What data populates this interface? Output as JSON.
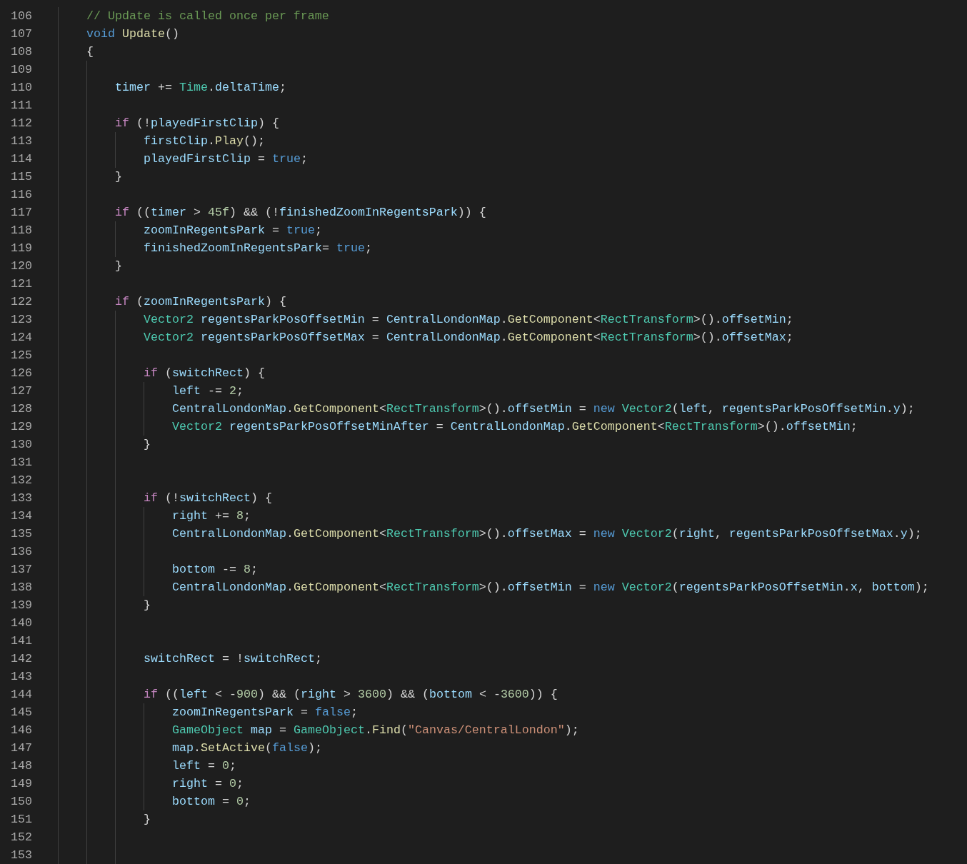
{
  "editor": {
    "lines": [
      {
        "number": "106",
        "tokens": [
          {
            "kind": "comment",
            "text": "// Update is called once per frame"
          }
        ]
      },
      {
        "number": "107",
        "tokens": [
          {
            "kind": "keyword",
            "text": "void "
          },
          {
            "kind": "function",
            "text": "Update"
          },
          {
            "kind": "plain",
            "text": "()"
          }
        ]
      },
      {
        "number": "108",
        "tokens": [
          {
            "kind": "plain",
            "text": "{"
          }
        ],
        "children": [
          {
            "number": "109"
          },
          {
            "number": "110",
            "tokens": [
              {
                "kind": "variable",
                "text": "timer"
              },
              {
                "kind": "plain",
                "text": " += "
              },
              {
                "kind": "type",
                "text": "Time"
              },
              {
                "kind": "plain",
                "text": "."
              },
              {
                "kind": "variable",
                "text": "deltaTime"
              },
              {
                "kind": "plain",
                "text": ";"
              }
            ]
          },
          {
            "number": "111"
          },
          {
            "number": "112",
            "tokens": [
              {
                "kind": "control",
                "text": "if"
              },
              {
                "kind": "plain",
                "text": " (!"
              },
              {
                "kind": "variable",
                "text": "playedFirstClip"
              },
              {
                "kind": "plain",
                "text": ") {"
              }
            ],
            "children": [
              {
                "number": "113",
                "tokens": [
                  {
                    "kind": "variable",
                    "text": "firstClip"
                  },
                  {
                    "kind": "plain",
                    "text": "."
                  },
                  {
                    "kind": "function",
                    "text": "Play"
                  },
                  {
                    "kind": "plain",
                    "text": "();"
                  }
                ]
              },
              {
                "number": "114",
                "tokens": [
                  {
                    "kind": "variable",
                    "text": "playedFirstClip"
                  },
                  {
                    "kind": "plain",
                    "text": " = "
                  },
                  {
                    "kind": "keyword",
                    "text": "true"
                  },
                  {
                    "kind": "plain",
                    "text": ";"
                  }
                ]
              }
            ]
          },
          {
            "number": "115",
            "tokens": [
              {
                "kind": "plain",
                "text": "}"
              }
            ]
          },
          {
            "number": "116"
          },
          {
            "number": "117",
            "tokens": [
              {
                "kind": "control",
                "text": "if"
              },
              {
                "kind": "plain",
                "text": " (("
              },
              {
                "kind": "variable",
                "text": "timer"
              },
              {
                "kind": "plain",
                "text": " > "
              },
              {
                "kind": "number",
                "text": "45f"
              },
              {
                "kind": "plain",
                "text": ") && (!"
              },
              {
                "kind": "variable",
                "text": "finishedZoomInRegentsPark"
              },
              {
                "kind": "plain",
                "text": ")) {"
              }
            ],
            "children": [
              {
                "number": "118",
                "tokens": [
                  {
                    "kind": "variable",
                    "text": "zoomInRegentsPark"
                  },
                  {
                    "kind": "plain",
                    "text": " = "
                  },
                  {
                    "kind": "keyword",
                    "text": "true"
                  },
                  {
                    "kind": "plain",
                    "text": ";"
                  }
                ]
              },
              {
                "number": "119",
                "tokens": [
                  {
                    "kind": "variable",
                    "text": "finishedZoomInRegentsPark"
                  },
                  {
                    "kind": "plain",
                    "text": "= "
                  },
                  {
                    "kind": "keyword",
                    "text": "true"
                  },
                  {
                    "kind": "plain",
                    "text": ";"
                  }
                ]
              }
            ]
          },
          {
            "number": "120",
            "tokens": [
              {
                "kind": "plain",
                "text": "}"
              }
            ]
          },
          {
            "number": "121"
          },
          {
            "number": "122",
            "tokens": [
              {
                "kind": "control",
                "text": "if"
              },
              {
                "kind": "plain",
                "text": " ("
              },
              {
                "kind": "variable",
                "text": "zoomInRegentsPark"
              },
              {
                "kind": "plain",
                "text": ") {"
              }
            ],
            "children": [
              {
                "number": "123",
                "tokens": [
                  {
                    "kind": "type",
                    "text": "Vector2 "
                  },
                  {
                    "kind": "variable",
                    "text": "regentsParkPosOffsetMin"
                  },
                  {
                    "kind": "plain",
                    "text": " = "
                  },
                  {
                    "kind": "variable",
                    "text": "CentralLondonMap"
                  },
                  {
                    "kind": "plain",
                    "text": "."
                  },
                  {
                    "kind": "function",
                    "text": "GetComponent"
                  },
                  {
                    "kind": "plain",
                    "text": "<"
                  },
                  {
                    "kind": "type",
                    "text": "RectTransform"
                  },
                  {
                    "kind": "plain",
                    "text": ">()."
                  },
                  {
                    "kind": "variable",
                    "text": "offsetMin"
                  },
                  {
                    "kind": "plain",
                    "text": ";"
                  }
                ]
              },
              {
                "number": "124",
                "tokens": [
                  {
                    "kind": "type",
                    "text": "Vector2 "
                  },
                  {
                    "kind": "variable",
                    "text": "regentsParkPosOffsetMax"
                  },
                  {
                    "kind": "plain",
                    "text": " = "
                  },
                  {
                    "kind": "variable",
                    "text": "CentralLondonMap"
                  },
                  {
                    "kind": "plain",
                    "text": "."
                  },
                  {
                    "kind": "function",
                    "text": "GetComponent"
                  },
                  {
                    "kind": "plain",
                    "text": "<"
                  },
                  {
                    "kind": "type",
                    "text": "RectTransform"
                  },
                  {
                    "kind": "plain",
                    "text": ">()."
                  },
                  {
                    "kind": "variable",
                    "text": "offsetMax"
                  },
                  {
                    "kind": "plain",
                    "text": ";"
                  }
                ]
              },
              {
                "number": "125"
              },
              {
                "number": "126",
                "tokens": [
                  {
                    "kind": "control",
                    "text": "if"
                  },
                  {
                    "kind": "plain",
                    "text": " ("
                  },
                  {
                    "kind": "variable",
                    "text": "switchRect"
                  },
                  {
                    "kind": "plain",
                    "text": ") {"
                  }
                ],
                "children": [
                  {
                    "number": "127",
                    "tokens": [
                      {
                        "kind": "variable",
                        "text": "left"
                      },
                      {
                        "kind": "plain",
                        "text": " -= "
                      },
                      {
                        "kind": "number",
                        "text": "2"
                      },
                      {
                        "kind": "plain",
                        "text": ";"
                      }
                    ]
                  },
                  {
                    "number": "128",
                    "tokens": [
                      {
                        "kind": "variable",
                        "text": "CentralLondonMap"
                      },
                      {
                        "kind": "plain",
                        "text": "."
                      },
                      {
                        "kind": "function",
                        "text": "GetComponent"
                      },
                      {
                        "kind": "plain",
                        "text": "<"
                      },
                      {
                        "kind": "type",
                        "text": "RectTransform"
                      },
                      {
                        "kind": "plain",
                        "text": ">()."
                      },
                      {
                        "kind": "variable",
                        "text": "offsetMin"
                      },
                      {
                        "kind": "plain",
                        "text": " = "
                      },
                      {
                        "kind": "keyword",
                        "text": "new "
                      },
                      {
                        "kind": "type",
                        "text": "Vector2"
                      },
                      {
                        "kind": "plain",
                        "text": "("
                      },
                      {
                        "kind": "variable",
                        "text": "left"
                      },
                      {
                        "kind": "plain",
                        "text": ", "
                      },
                      {
                        "kind": "variable",
                        "text": "regentsParkPosOffsetMin"
                      },
                      {
                        "kind": "plain",
                        "text": "."
                      },
                      {
                        "kind": "variable",
                        "text": "y"
                      },
                      {
                        "kind": "plain",
                        "text": ");"
                      }
                    ]
                  },
                  {
                    "number": "129",
                    "tokens": [
                      {
                        "kind": "type",
                        "text": "Vector2 "
                      },
                      {
                        "kind": "variable",
                        "text": "regentsParkPosOffsetMinAfter"
                      },
                      {
                        "kind": "plain",
                        "text": " = "
                      },
                      {
                        "kind": "variable",
                        "text": "CentralLondonMap"
                      },
                      {
                        "kind": "plain",
                        "text": "."
                      },
                      {
                        "kind": "function",
                        "text": "GetComponent"
                      },
                      {
                        "kind": "plain",
                        "text": "<"
                      },
                      {
                        "kind": "type",
                        "text": "RectTransform"
                      },
                      {
                        "kind": "plain",
                        "text": ">()."
                      },
                      {
                        "kind": "variable",
                        "text": "offsetMin"
                      },
                      {
                        "kind": "plain",
                        "text": ";"
                      }
                    ]
                  }
                ]
              },
              {
                "number": "130",
                "tokens": [
                  {
                    "kind": "plain",
                    "text": "}"
                  }
                ]
              },
              {
                "number": "131"
              },
              {
                "number": "132"
              },
              {
                "number": "133",
                "tokens": [
                  {
                    "kind": "control",
                    "text": "if"
                  },
                  {
                    "kind": "plain",
                    "text": " (!"
                  },
                  {
                    "kind": "variable",
                    "text": "switchRect"
                  },
                  {
                    "kind": "plain",
                    "text": ") {"
                  }
                ],
                "children": [
                  {
                    "number": "134",
                    "tokens": [
                      {
                        "kind": "variable",
                        "text": "right"
                      },
                      {
                        "kind": "plain",
                        "text": " += "
                      },
                      {
                        "kind": "number",
                        "text": "8"
                      },
                      {
                        "kind": "plain",
                        "text": ";"
                      }
                    ]
                  },
                  {
                    "number": "135",
                    "tokens": [
                      {
                        "kind": "variable",
                        "text": "CentralLondonMap"
                      },
                      {
                        "kind": "plain",
                        "text": "."
                      },
                      {
                        "kind": "function",
                        "text": "GetComponent"
                      },
                      {
                        "kind": "plain",
                        "text": "<"
                      },
                      {
                        "kind": "type",
                        "text": "RectTransform"
                      },
                      {
                        "kind": "plain",
                        "text": ">()."
                      },
                      {
                        "kind": "variable",
                        "text": "offsetMax"
                      },
                      {
                        "kind": "plain",
                        "text": " = "
                      },
                      {
                        "kind": "keyword",
                        "text": "new "
                      },
                      {
                        "kind": "type",
                        "text": "Vector2"
                      },
                      {
                        "kind": "plain",
                        "text": "("
                      },
                      {
                        "kind": "variable",
                        "text": "right"
                      },
                      {
                        "kind": "plain",
                        "text": ", "
                      },
                      {
                        "kind": "variable",
                        "text": "regentsParkPosOffsetMax"
                      },
                      {
                        "kind": "plain",
                        "text": "."
                      },
                      {
                        "kind": "variable",
                        "text": "y"
                      },
                      {
                        "kind": "plain",
                        "text": ");"
                      }
                    ]
                  },
                  {
                    "number": "136"
                  },
                  {
                    "number": "137",
                    "tokens": [
                      {
                        "kind": "variable",
                        "text": "bottom"
                      },
                      {
                        "kind": "plain",
                        "text": " -= "
                      },
                      {
                        "kind": "number",
                        "text": "8"
                      },
                      {
                        "kind": "plain",
                        "text": ";"
                      }
                    ]
                  },
                  {
                    "number": "138",
                    "tokens": [
                      {
                        "kind": "variable",
                        "text": "CentralLondonMap"
                      },
                      {
                        "kind": "plain",
                        "text": "."
                      },
                      {
                        "kind": "function",
                        "text": "GetComponent"
                      },
                      {
                        "kind": "plain",
                        "text": "<"
                      },
                      {
                        "kind": "type",
                        "text": "RectTransform"
                      },
                      {
                        "kind": "plain",
                        "text": ">()."
                      },
                      {
                        "kind": "variable",
                        "text": "offsetMin"
                      },
                      {
                        "kind": "plain",
                        "text": " = "
                      },
                      {
                        "kind": "keyword",
                        "text": "new "
                      },
                      {
                        "kind": "type",
                        "text": "Vector2"
                      },
                      {
                        "kind": "plain",
                        "text": "("
                      },
                      {
                        "kind": "variable",
                        "text": "regentsParkPosOffsetMin"
                      },
                      {
                        "kind": "plain",
                        "text": "."
                      },
                      {
                        "kind": "variable",
                        "text": "x"
                      },
                      {
                        "kind": "plain",
                        "text": ", "
                      },
                      {
                        "kind": "variable",
                        "text": "bottom"
                      },
                      {
                        "kind": "plain",
                        "text": ");"
                      }
                    ]
                  }
                ]
              },
              {
                "number": "139",
                "tokens": [
                  {
                    "kind": "plain",
                    "text": "}"
                  }
                ]
              },
              {
                "number": "140"
              },
              {
                "number": "141"
              },
              {
                "number": "142",
                "tokens": [
                  {
                    "kind": "variable",
                    "text": "switchRect"
                  },
                  {
                    "kind": "plain",
                    "text": " = !"
                  },
                  {
                    "kind": "variable",
                    "text": "switchRect"
                  },
                  {
                    "kind": "plain",
                    "text": ";"
                  }
                ]
              },
              {
                "number": "143"
              },
              {
                "number": "144",
                "tokens": [
                  {
                    "kind": "control",
                    "text": "if"
                  },
                  {
                    "kind": "plain",
                    "text": " (("
                  },
                  {
                    "kind": "variable",
                    "text": "left"
                  },
                  {
                    "kind": "plain",
                    "text": " < -"
                  },
                  {
                    "kind": "number",
                    "text": "900"
                  },
                  {
                    "kind": "plain",
                    "text": ") && ("
                  },
                  {
                    "kind": "variable",
                    "text": "right"
                  },
                  {
                    "kind": "plain",
                    "text": " > "
                  },
                  {
                    "kind": "number",
                    "text": "3600"
                  },
                  {
                    "kind": "plain",
                    "text": ") && ("
                  },
                  {
                    "kind": "variable",
                    "text": "bottom"
                  },
                  {
                    "kind": "plain",
                    "text": " < -"
                  },
                  {
                    "kind": "number",
                    "text": "3600"
                  },
                  {
                    "kind": "plain",
                    "text": ")) {"
                  }
                ],
                "children": [
                  {
                    "number": "145",
                    "tokens": [
                      {
                        "kind": "variable",
                        "text": "zoomInRegentsPark"
                      },
                      {
                        "kind": "plain",
                        "text": " = "
                      },
                      {
                        "kind": "keyword",
                        "text": "false"
                      },
                      {
                        "kind": "plain",
                        "text": ";"
                      }
                    ]
                  },
                  {
                    "number": "146",
                    "tokens": [
                      {
                        "kind": "type",
                        "text": "GameObject "
                      },
                      {
                        "kind": "variable",
                        "text": "map"
                      },
                      {
                        "kind": "plain",
                        "text": " = "
                      },
                      {
                        "kind": "type",
                        "text": "GameObject"
                      },
                      {
                        "kind": "plain",
                        "text": "."
                      },
                      {
                        "kind": "function",
                        "text": "Find"
                      },
                      {
                        "kind": "plain",
                        "text": "("
                      },
                      {
                        "kind": "string",
                        "text": "\"Canvas/CentralLondon\""
                      },
                      {
                        "kind": "plain",
                        "text": ");"
                      }
                    ]
                  },
                  {
                    "number": "147",
                    "tokens": [
                      {
                        "kind": "variable",
                        "text": "map"
                      },
                      {
                        "kind": "plain",
                        "text": "."
                      },
                      {
                        "kind": "function",
                        "text": "SetActive"
                      },
                      {
                        "kind": "plain",
                        "text": "("
                      },
                      {
                        "kind": "keyword",
                        "text": "false"
                      },
                      {
                        "kind": "plain",
                        "text": ");"
                      }
                    ]
                  },
                  {
                    "number": "148",
                    "tokens": [
                      {
                        "kind": "variable",
                        "text": "left"
                      },
                      {
                        "kind": "plain",
                        "text": " = "
                      },
                      {
                        "kind": "number",
                        "text": "0"
                      },
                      {
                        "kind": "plain",
                        "text": ";"
                      }
                    ]
                  },
                  {
                    "number": "149",
                    "tokens": [
                      {
                        "kind": "variable",
                        "text": "right"
                      },
                      {
                        "kind": "plain",
                        "text": " = "
                      },
                      {
                        "kind": "number",
                        "text": "0"
                      },
                      {
                        "kind": "plain",
                        "text": ";"
                      }
                    ]
                  },
                  {
                    "number": "150",
                    "tokens": [
                      {
                        "kind": "variable",
                        "text": "bottom"
                      },
                      {
                        "kind": "plain",
                        "text": " = "
                      },
                      {
                        "kind": "number",
                        "text": "0"
                      },
                      {
                        "kind": "plain",
                        "text": ";"
                      }
                    ]
                  }
                ]
              },
              {
                "number": "151",
                "tokens": [
                  {
                    "kind": "plain",
                    "text": "}"
                  }
                ]
              },
              {
                "number": "152"
              },
              {
                "number": "153"
              }
            ]
          }
        ]
      }
    ]
  }
}
